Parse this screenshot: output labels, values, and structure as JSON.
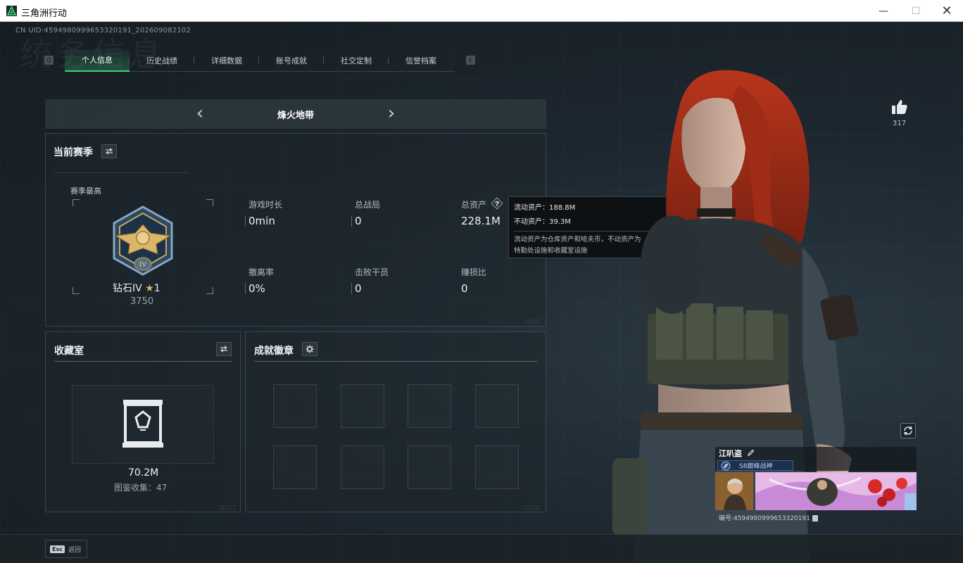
{
  "window": {
    "title": "三角洲行动",
    "minimize_glyph": "—",
    "maximize_glyph": "☐",
    "close_glyph": "✕"
  },
  "header": {
    "uid_text": "CN UID:4594980999653320191_202609082102",
    "watermark": "统务信息",
    "prev_key": "Q",
    "next_key": "E"
  },
  "tabs": [
    {
      "label": "个人信息",
      "active": true
    },
    {
      "label": "历史战绩",
      "active": false
    },
    {
      "label": "详细数据",
      "active": false
    },
    {
      "label": "账号成就",
      "active": false
    },
    {
      "label": "社交定制",
      "active": false
    },
    {
      "label": "信誉档案",
      "active": false
    }
  ],
  "mode": {
    "title": "烽火地带",
    "prev_glyph": "‹",
    "next_glyph": "›"
  },
  "season": {
    "title": "当前赛季",
    "switch_icon": "swap-icon",
    "best_label": "赛季最高",
    "rank_name": "钻石IV",
    "rank_stars": "1",
    "rank_score": "3750",
    "medal_numeral": "IV",
    "stats": {
      "play_time_label": "游戏时长",
      "play_time_value": "0min",
      "total_matches_label": "总战局",
      "total_matches_value": "0",
      "total_assets_label": "总资产",
      "total_assets_value": "228.1M",
      "extract_rate_label": "撤离率",
      "extract_rate_value": "0%",
      "kills_label": "击败干员",
      "kills_value": "0",
      "profit_ratio_label": "赚损比",
      "profit_ratio_value": "0"
    }
  },
  "tooltip": {
    "liquid": "流动资产：188.8M",
    "fixed": "不动资产：39.3M",
    "desc_1": "流动资产为仓库资产和哈夫币，不动资产为",
    "desc_2": "特勤处设施和收藏室设施"
  },
  "collection": {
    "title": "收藏室",
    "value": "70.2M",
    "count_text": "图鉴收集：47"
  },
  "achievements": {
    "title": "成就徽章",
    "slots": 8
  },
  "profile": {
    "like_count": "317",
    "player_name": "江叭盗",
    "player_title": "S8巅峰战神",
    "id_text": "编号:4594980999653320191"
  },
  "footer": {
    "esc_key": "Esc",
    "esc_label": "返回"
  },
  "colors": {
    "accent": "#3ed07a",
    "background": "#1a2229",
    "panel_border": "#3a454c"
  }
}
